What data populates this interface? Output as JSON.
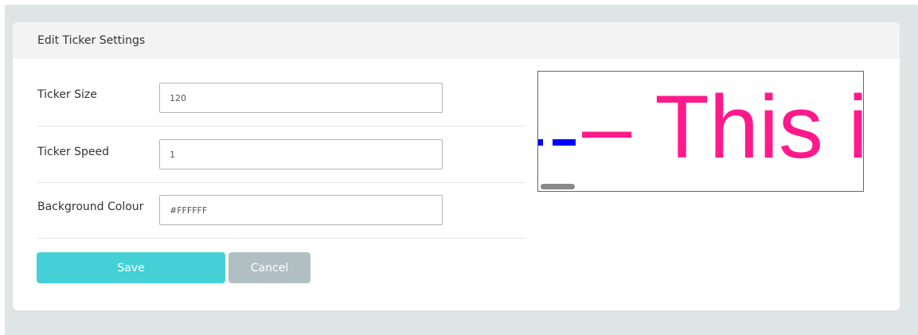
{
  "panel": {
    "title": "Edit Ticker Settings"
  },
  "form": {
    "ticker_size": {
      "label": "Ticker Size",
      "value": "120"
    },
    "ticker_speed": {
      "label": "Ticker Speed",
      "value": "1"
    },
    "background_colour": {
      "label": "Background Colour",
      "value": "#FFFFFF"
    }
  },
  "buttons": {
    "save_label": "Save",
    "cancel_label": "Cancel"
  },
  "preview": {
    "ticker_text": "– This is",
    "text_color": "#FF1A8C",
    "dash_color": "#0000FF",
    "background_color": "#FFFFFF"
  },
  "colors": {
    "page_background": "#DFE5E4",
    "header_background": "#F3F3F3",
    "save_button": "#45D0D8",
    "cancel_button": "#B1BFC3"
  }
}
